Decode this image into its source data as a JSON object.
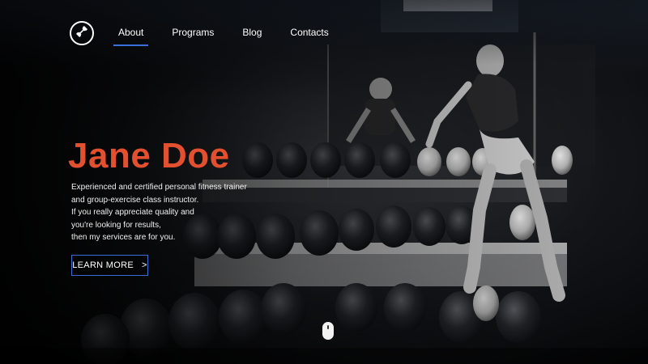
{
  "nav": {
    "items": [
      {
        "label": "About",
        "active": true
      },
      {
        "label": "Programs",
        "active": false
      },
      {
        "label": "Blog",
        "active": false
      },
      {
        "label": "Contacts",
        "active": false
      }
    ]
  },
  "hero": {
    "title": "Jane Doe",
    "description_lines": [
      "Experienced and certified personal fitness trainer",
      "and group-exercise class instructor.",
      "If you really appreciate quality and",
      "you're looking for results,",
      "then my services are for you."
    ],
    "cta_label": "LEARN MORE",
    "cta_arrow": ">"
  },
  "icons": {
    "logo": "dumbbell-icon",
    "scroll": "mouse-scroll-icon"
  },
  "colors": {
    "accent": "#e3502f",
    "nav_underline": "#3b6fd8",
    "button_border": "#3b6fd8",
    "background": "#050607"
  }
}
